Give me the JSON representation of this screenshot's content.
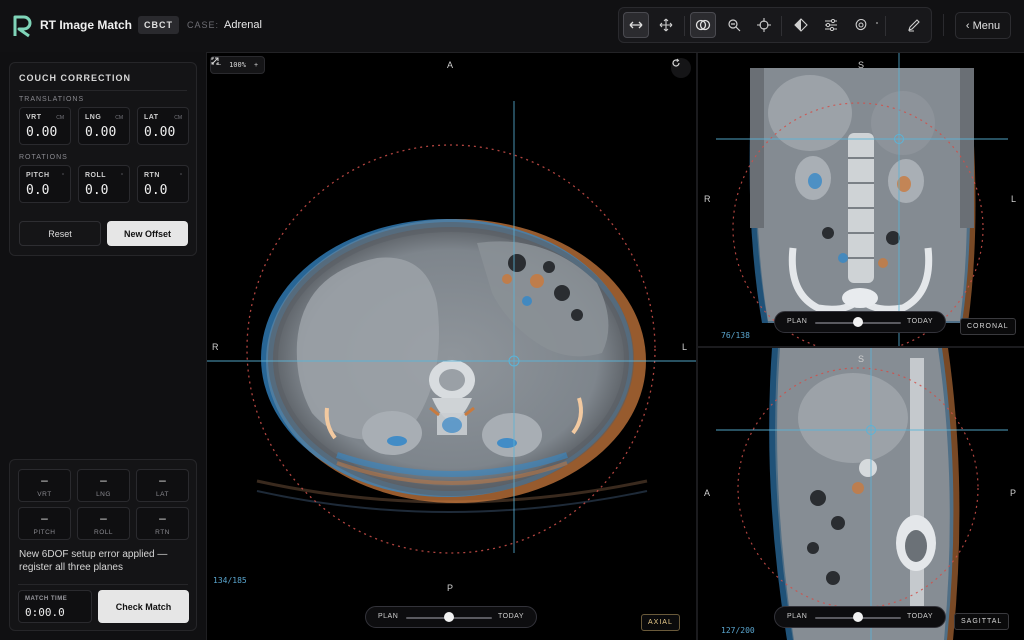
{
  "header": {
    "app_title": "RT Image Match",
    "modality": "CBCT",
    "case_label": "CASE:",
    "case_value": "Adrenal",
    "menu_label": "‹ Menu",
    "toolbar_icons": [
      "swap-arrows-icon",
      "move-icon",
      "overlay-icon",
      "zoom-icon",
      "crosshair-icon",
      "window-level-icon",
      "sliders-icon",
      "contour-icon",
      "pen-icon"
    ]
  },
  "couch_correction": {
    "title": "COUCH CORRECTION",
    "translations_label": "TRANSLATIONS",
    "translations": [
      {
        "label": "VRT",
        "unit": "CM",
        "value": "0.00"
      },
      {
        "label": "LNG",
        "unit": "CM",
        "value": "0.00"
      },
      {
        "label": "LAT",
        "unit": "CM",
        "value": "0.00"
      }
    ],
    "rotations_label": "ROTATIONS",
    "rotations": [
      {
        "label": "PITCH",
        "unit": "°",
        "value": "0.0"
      },
      {
        "label": "ROLL",
        "unit": "°",
        "value": "0.0"
      },
      {
        "label": "RTN",
        "unit": "°",
        "value": "0.0"
      }
    ],
    "reset_label": "Reset",
    "new_offset_label": "New Offset"
  },
  "setup_error": {
    "cells": [
      {
        "label": "VRT",
        "value": "–"
      },
      {
        "label": "LNG",
        "value": "–"
      },
      {
        "label": "LAT",
        "value": "–"
      },
      {
        "label": "PITCH",
        "value": "–"
      },
      {
        "label": "ROLL",
        "value": "–"
      },
      {
        "label": "RTN",
        "value": "–"
      }
    ],
    "message": "New 6DOF setup error applied — register all three planes",
    "match_time_label": "MATCH TIME",
    "match_time_value": "0:00.0",
    "check_match_label": "Check Match"
  },
  "axial": {
    "zoom": "100%",
    "zoom_minus": "−",
    "zoom_plus": "+",
    "slice": "134/185",
    "orient_top": "A",
    "orient_bottom": "P",
    "orient_left": "R",
    "orient_right": "L",
    "view_tag": "AXIAL",
    "slider_left": "PLAN",
    "slider_right": "TODAY",
    "blend": 0.5
  },
  "coronal": {
    "slice": "76/138",
    "orient_top": "S",
    "orient_left": "R",
    "orient_right": "L",
    "view_tag": "CORONAL",
    "slider_left": "PLAN",
    "slider_right": "TODAY",
    "blend": 0.5
  },
  "sagittal": {
    "slice": "127/200",
    "orient_top": "S",
    "orient_left": "A",
    "orient_right": "P",
    "view_tag": "SAGITTAL",
    "slider_left": "PLAN",
    "slider_right": "TODAY",
    "blend": 0.5
  },
  "colors": {
    "plan": "#d07a3a",
    "today": "#3a8fd0",
    "crosshair": "#5ab4d8",
    "isodose": "#d0504a",
    "accent": "#e7c98a"
  }
}
